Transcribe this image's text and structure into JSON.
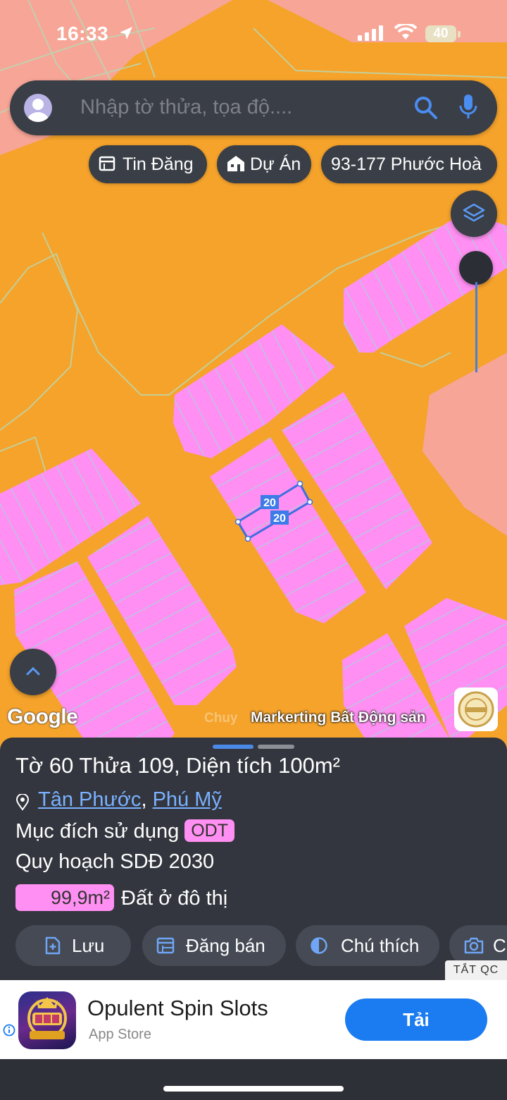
{
  "status_bar": {
    "time": "16:33",
    "battery": "40"
  },
  "search": {
    "placeholder": "Nhập tờ thửa, tọa độ...."
  },
  "chips": [
    {
      "label": "Tin Đăng",
      "icon": "listing-icon"
    },
    {
      "label": "Dự Án",
      "icon": "building-icon"
    },
    {
      "label": "93-177 Phước Hoà",
      "icon": ""
    }
  ],
  "map": {
    "parcel_labels": [
      "20",
      "20"
    ],
    "google_logo": "Google",
    "watermark_faint": "Chuy",
    "watermark": "Markerting Bất Động sản"
  },
  "sheet": {
    "title_prefix": "Tờ ",
    "sheet_no": "60",
    "title_mid": " Thửa ",
    "parcel_no": "109",
    "title_suffix": ", Diện tích ",
    "area": "100m²",
    "ward": "Tân Phước",
    "separator": ", ",
    "town": "Phú Mỹ",
    "purpose_label": "Mục đích sử dụng",
    "purpose_code": "ODT",
    "plan_label": "Quy hoạch SDĐ 2030",
    "plan_area": "99,9m²",
    "plan_type": "Đất ở đô thị"
  },
  "actions": [
    {
      "label": "Lưu",
      "icon": "save-doc-icon"
    },
    {
      "label": "Đăng bán",
      "icon": "calendar-icon"
    },
    {
      "label": "Chú thích",
      "icon": "half-circle-icon"
    },
    {
      "label": "C",
      "icon": "camera-icon"
    }
  ],
  "hide_ads": "TẮT QC",
  "ad": {
    "app_name": "Opulent Spin Slots",
    "store": "App Store",
    "button": "Tải"
  },
  "colors": {
    "map_orange": "#f5a32b",
    "parcel_pink": "#ff8ff2",
    "parcel_line": "#9ed9d9",
    "salmon_zone": "#f7a596",
    "panel_dark": "#33363e",
    "link_blue": "#7ab1ff",
    "accent_blue": "#1a7cf0"
  }
}
